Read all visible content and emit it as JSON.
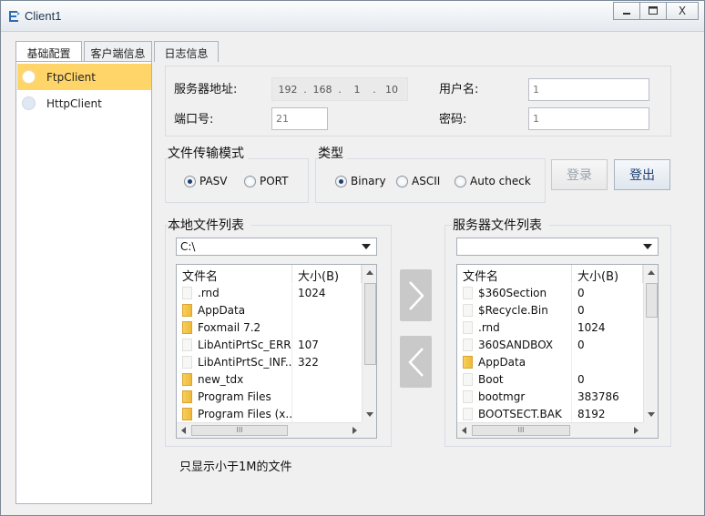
{
  "window": {
    "title": "Client1",
    "minimize": "—",
    "maximize": "☐",
    "close": "X"
  },
  "tabs": [
    {
      "label": "基础配置"
    },
    {
      "label": "客户端信息"
    },
    {
      "label": "日志信息"
    }
  ],
  "sidebar": {
    "items": [
      {
        "label": "FtpClient",
        "selected": true
      },
      {
        "label": "HttpClient",
        "selected": false
      }
    ]
  },
  "connection": {
    "server_label": "服务器地址:",
    "ip": [
      "192",
      "168",
      "1",
      "10"
    ],
    "ip_sep": ".",
    "port_label": "端口号:",
    "port_value": "21",
    "user_label": "用户名:",
    "user_value": "1",
    "password_label": "密码:",
    "password_value": "1"
  },
  "transfer_mode": {
    "title": "文件传输模式",
    "options": [
      {
        "label": "PASV",
        "checked": true
      },
      {
        "label": "PORT",
        "checked": false
      }
    ]
  },
  "type_group": {
    "title": "类型",
    "options": [
      {
        "label": "Binary",
        "checked": true
      },
      {
        "label": "ASCII",
        "checked": false
      },
      {
        "label": "Auto check",
        "checked": false
      }
    ]
  },
  "actions": {
    "login": "登录",
    "logout": "登出"
  },
  "local": {
    "title": "本地文件列表",
    "path": "C:\\",
    "col_name": "文件名",
    "col_size": "大小(B)",
    "rows": [
      {
        "name": ".rnd",
        "size": "1024",
        "icon": "file-icon"
      },
      {
        "name": "AppData",
        "size": "",
        "icon": "folder-icon"
      },
      {
        "name": "Foxmail 7.2",
        "size": "",
        "icon": "folder-icon"
      },
      {
        "name": "LibAntiPrtSc_ERR...",
        "size": "107",
        "icon": "file-icon"
      },
      {
        "name": "LibAntiPrtSc_INF...",
        "size": "322",
        "icon": "file-icon"
      },
      {
        "name": "new_tdx",
        "size": "",
        "icon": "folder-icon"
      },
      {
        "name": "Program Files",
        "size": "",
        "icon": "folder-icon"
      },
      {
        "name": "Program Files (x...",
        "size": "",
        "icon": "folder-icon"
      }
    ]
  },
  "remote": {
    "title": "服务器文件列表",
    "path": "",
    "col_name": "文件名",
    "col_size": "大小(B)",
    "rows": [
      {
        "name": "$360Section",
        "size": "0",
        "icon": "file-icon"
      },
      {
        "name": "$Recycle.Bin",
        "size": "0",
        "icon": "file-icon"
      },
      {
        "name": ".rnd",
        "size": "1024",
        "icon": "file-icon"
      },
      {
        "name": "360SANDBOX",
        "size": "0",
        "icon": "file-icon"
      },
      {
        "name": "AppData",
        "size": "",
        "icon": "folder-icon"
      },
      {
        "name": "Boot",
        "size": "0",
        "icon": "file-icon"
      },
      {
        "name": "bootmgr",
        "size": "383786",
        "icon": "file-icon"
      },
      {
        "name": "BOOTSECT.BAK",
        "size": "8192",
        "icon": "file-icon"
      }
    ]
  },
  "scroll_grip": "III",
  "note": "只显示小于1M的文件"
}
